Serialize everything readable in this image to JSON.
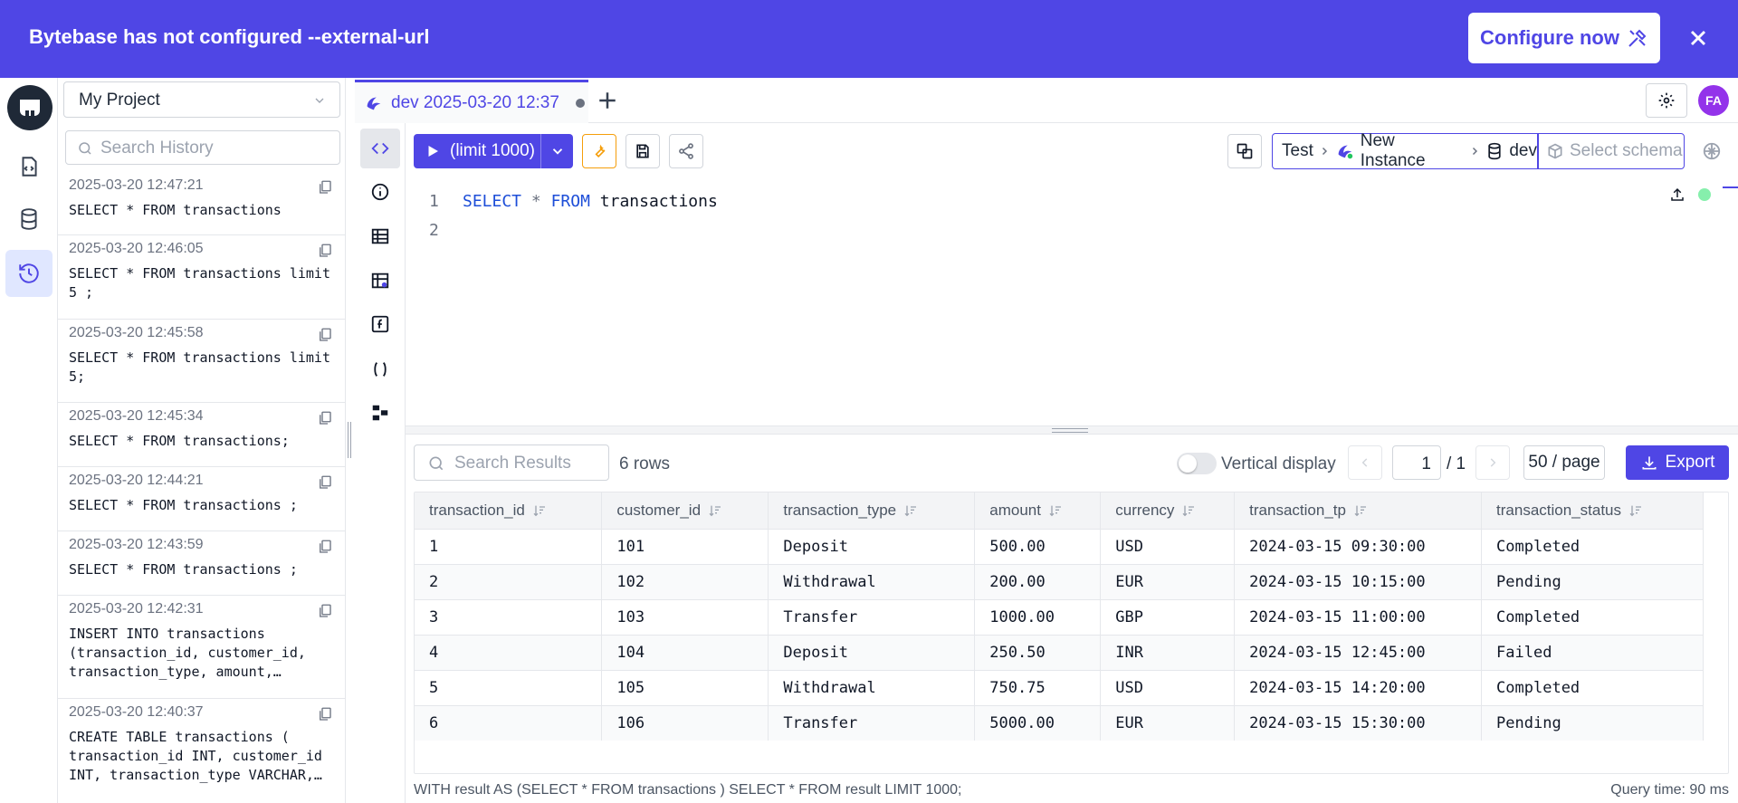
{
  "banner": {
    "message": "Bytebase has not configured --external-url",
    "configure_label": "Configure now"
  },
  "project": {
    "selected": "My Project"
  },
  "history": {
    "search_placeholder": "Search History",
    "items": [
      {
        "time": "2025-03-20 12:47:21",
        "sql": "SELECT * FROM transactions"
      },
      {
        "time": "2025-03-20 12:46:05",
        "sql": "SELECT * FROM transactions limit\n5 ;"
      },
      {
        "time": "2025-03-20 12:45:58",
        "sql": "SELECT * FROM transactions limit\n5;"
      },
      {
        "time": "2025-03-20 12:45:34",
        "sql": "SELECT * FROM transactions;"
      },
      {
        "time": "2025-03-20 12:44:21",
        "sql": "SELECT * FROM transactions ;"
      },
      {
        "time": "2025-03-20 12:43:59",
        "sql": "SELECT * FROM transactions ;"
      },
      {
        "time": "2025-03-20 12:42:31",
        "sql": "INSERT INTO transactions\n(transaction_id, customer_id,\ntransaction_type, amount,…"
      },
      {
        "time": "2025-03-20 12:40:37",
        "sql": "CREATE TABLE transactions (\ntransaction_id INT, customer_id\nINT, transaction_type VARCHAR,…"
      }
    ]
  },
  "tabs": [
    {
      "label": "dev 2025-03-20 12:37"
    }
  ],
  "user": {
    "initials": "FA"
  },
  "toolbar": {
    "run_label": "(limit 1000)",
    "env": "Test",
    "instance": "New Instance",
    "database": "dev",
    "schema_placeholder": "Select schema"
  },
  "editor": {
    "line_numbers": [
      "1",
      "2"
    ],
    "line1": {
      "kw1": "SELECT",
      "star": "*",
      "kw2": "FROM",
      "table": "transactions"
    }
  },
  "results": {
    "search_placeholder": "Search Results",
    "row_count": "6 rows",
    "vertical_display_label": "Vertical display",
    "page": "1",
    "page_total": "/ 1",
    "per_page": "50 / page",
    "export_label": "Export",
    "columns": [
      "transaction_id",
      "customer_id",
      "transaction_type",
      "amount",
      "currency",
      "transaction_tp",
      "transaction_status"
    ],
    "rows": [
      [
        "1",
        "101",
        "Deposit",
        "500.00",
        "USD",
        "2024-03-15 09:30:00",
        "Completed"
      ],
      [
        "2",
        "102",
        "Withdrawal",
        "200.00",
        "EUR",
        "2024-03-15 10:15:00",
        "Pending"
      ],
      [
        "3",
        "103",
        "Transfer",
        "1000.00",
        "GBP",
        "2024-03-15 11:00:00",
        "Completed"
      ],
      [
        "4",
        "104",
        "Deposit",
        "250.50",
        "INR",
        "2024-03-15 12:45:00",
        "Failed"
      ],
      [
        "5",
        "105",
        "Withdrawal",
        "750.75",
        "USD",
        "2024-03-15 14:20:00",
        "Completed"
      ],
      [
        "6",
        "106",
        "Transfer",
        "5000.00",
        "EUR",
        "2024-03-15 15:30:00",
        "Pending"
      ]
    ],
    "executed_sql": "WITH result AS (SELECT * FROM transactions ) SELECT * FROM result LIMIT 1000;",
    "query_time": "Query time: 90 ms"
  },
  "colors": {
    "accent": "#4f46e5",
    "warning": "#f59e0b",
    "success": "#86efac",
    "avatar": "#9333ea"
  }
}
